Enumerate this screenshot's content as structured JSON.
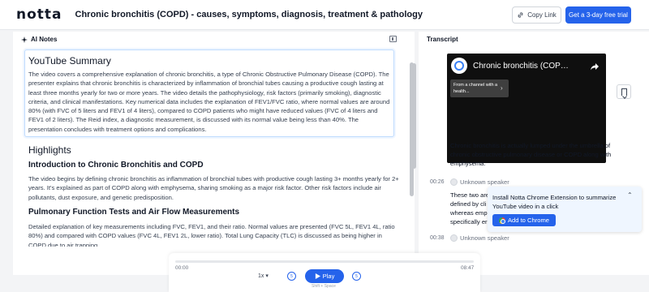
{
  "header": {
    "logo": "notta",
    "title": "Chronic bronchitis (COPD) - causes, symptoms, diagnosis, treatment & pathology",
    "copy_link_label": "Copy Link",
    "trial_label": "Get a 3-day free trial"
  },
  "notes": {
    "header_label": "AI Notes",
    "summary_title": "YouTube Summary",
    "summary_text": "The video covers a comprehensive explanation of chronic bronchitis, a type of Chronic Obstructive Pulmonary Disease (COPD). The presenter explains that chronic bronchitis is characterized by inflammation of bronchial tubes causing a productive cough lasting at least three months yearly for two or more years. The video details the pathophysiology, risk factors (primarily smoking), diagnostic criteria, and clinical manifestations. Key numerical data includes the explanation of FEV1/FVC ratio, where normal values are around 80% (with FVC of 5 liters and FEV1 of 4 liters), compared to COPD patients who might have reduced values (FVC of 4 liters and FEV1 of 2 liters). The Reid index, a diagnostic measurement, is discussed with its normal value being less than 40%. The presentation concludes with treatment options and complications.",
    "highlights_title": "Highlights",
    "sections": [
      {
        "heading": "Introduction to Chronic Bronchitis and COPD",
        "text": "The video begins by defining chronic bronchitis as inflammation of bronchial tubes with productive cough lasting 3+ months yearly for 2+ years. It's explained as part of COPD along with emphysema, sharing smoking as a major risk factor. Other risk factors include air pollutants, dust exposure, and genetic predisposition."
      },
      {
        "heading": "Pulmonary Function Tests and Air Flow Measurements",
        "text": "Detailed explanation of key measurements including FVC, FEV1, and their ratio. Normal values are presented (FVC 5L, FEV1 4L, ratio 80%) and compared with COPD values (FVC 4L, FEV1 2L, lower ratio). Total Lung Capacity (TLC) is discussed as being higher in COPD due to air trapping."
      }
    ]
  },
  "transcript": {
    "title": "Transcript",
    "video_title": "Chronic bronchitis (COPD...",
    "video_chip": "From a channel with a health...",
    "segment1_text": "Chronic bronchitis is actually lumped under the umbrella of chronic obstructive pulmonary disease or COPD along with emphysema.",
    "segment2_time": "00:26",
    "segment2_speaker": "Unknown speaker",
    "segment2_text": "These two are defined by cli whereas emp specifically er",
    "segment3_time": "00:38",
    "segment3_speaker": "Unknown speaker"
  },
  "extension_popup": {
    "text": "Install Notta Chrome Extension to summarize YouTube video in a click",
    "button_label": "Add to Chrome"
  },
  "player": {
    "current_time": "00:00",
    "duration": "08:47",
    "speed": "1x",
    "play_label": "Play",
    "shortcut_hint": "Shift + Space",
    "progress": 0
  }
}
